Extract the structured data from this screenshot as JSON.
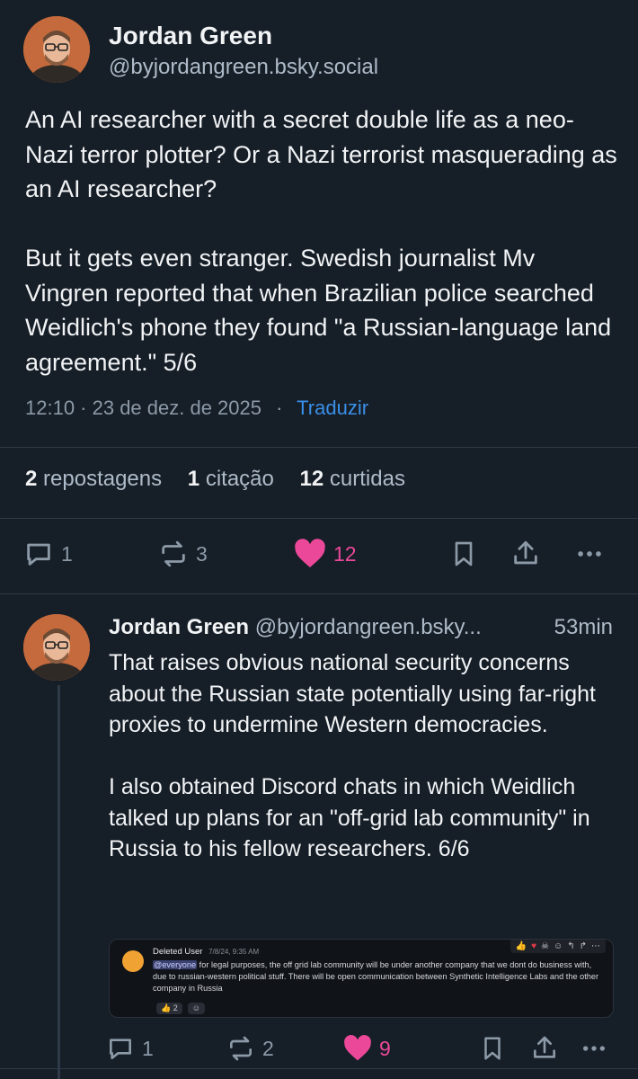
{
  "main_post": {
    "author_name": "Jordan Green",
    "author_handle": "@byjordangreen.bsky.social",
    "text": "An AI researcher with a secret double life as a neo-Nazi terror plotter? Or a Nazi terrorist masquerading as an AI researcher?\n\nBut it gets even stranger. Swedish journalist Mv Vingren reported that when Brazilian police searched Weidlich's phone they found \"a Russian-language land agreement.\" 5/6",
    "timestamp": "12:10 · 23 de dez. de 2025",
    "separator": "·",
    "translate_label": "Traduzir",
    "stats": {
      "reposts_count": "2",
      "reposts_label": "repostagens",
      "quotes_count": "1",
      "quotes_label": "citação",
      "likes_count": "12",
      "likes_label": "curtidas"
    },
    "actions": {
      "reply_count": "1",
      "repost_count": "3",
      "like_count": "12",
      "liked": true
    }
  },
  "reply_post": {
    "author_name": "Jordan Green",
    "author_handle": "@byjordangreen.bsky...",
    "time_ago": "53min",
    "text": "That raises obvious national security concerns about the Russian state potentially using far-right proxies to undermine Western democracies.\n\nI also obtained Discord chats in which Weidlich talked up plans for an \"off-grid lab community\" in Russia to his fellow researchers. 6/6",
    "embed": {
      "user": "Deleted User",
      "time": "7/8/24, 9:35 AM",
      "mention": "@everyone",
      "message": " for legal purposes, the off grid lab community will be under another company that we dont do business with, due to russian-western political stuff. There will be open communication between Synthetic Intelligence Labs and the other company in Russia",
      "reaction_count": "2"
    },
    "actions": {
      "reply_count": "1",
      "repost_count": "2",
      "like_count": "9",
      "liked": true
    }
  },
  "colors": {
    "background": "#161e27",
    "text": "#f1f3f5",
    "muted": "#8c9aa8",
    "link": "#3b8fe8",
    "like": "#ec4899"
  }
}
